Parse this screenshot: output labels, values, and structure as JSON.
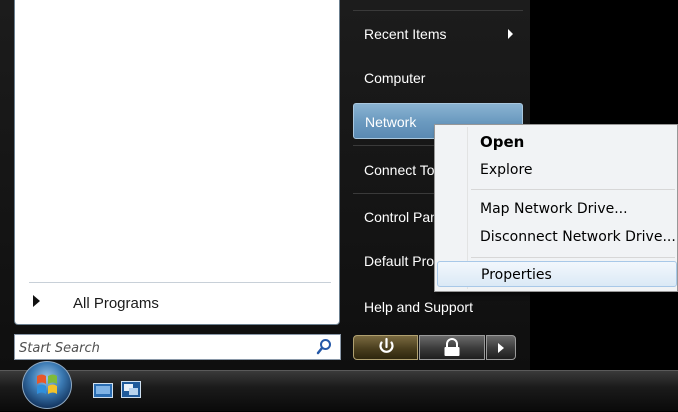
{
  "left_pane": {
    "all_programs_label": "All Programs"
  },
  "search": {
    "placeholder": "Start Search",
    "icon": "search-icon"
  },
  "right_pane": {
    "items": [
      {
        "label": "Recent Items",
        "has_submenu": true
      },
      {
        "label": "Computer"
      },
      {
        "label": "Network",
        "highlighted": true
      },
      {
        "label": "Connect To"
      },
      {
        "label": "Control Panel"
      },
      {
        "label": "Default Programs"
      },
      {
        "label": "Help and Support"
      }
    ]
  },
  "power_buttons": {
    "power_icon": "power-icon",
    "lock_icon": "lock-icon",
    "more_icon": "arrow-right-icon"
  },
  "context_menu": {
    "items": [
      {
        "label": "Open",
        "bold": true
      },
      {
        "label": "Explore"
      },
      {
        "label": "Map Network Drive..."
      },
      {
        "label": "Disconnect Network Drive..."
      },
      {
        "label": "Properties",
        "hovered": true
      }
    ]
  },
  "taskbar": {
    "start_icon": "windows-orb-icon",
    "quick_launch": [
      "show-desktop-icon",
      "switch-windows-icon"
    ]
  },
  "colors": {
    "highlight": "#6c9bc0",
    "menu_hover": "#dbe9f6",
    "background": "#000000"
  }
}
